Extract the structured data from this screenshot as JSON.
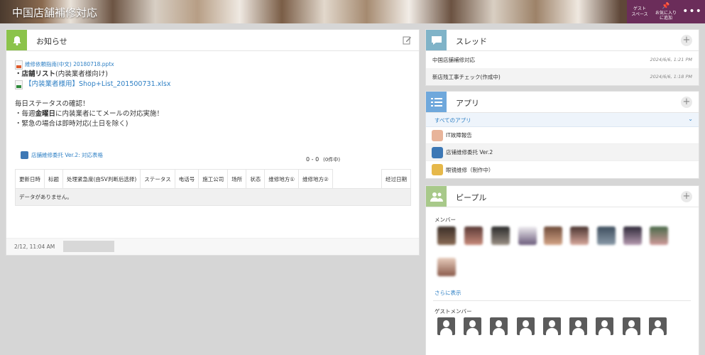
{
  "header": {
    "title": "中国店舗補修対応",
    "guest_space": [
      "ゲスト",
      "スペース"
    ],
    "favorite": [
      "お気に入り",
      "に追加"
    ],
    "more": "•••"
  },
  "notice": {
    "title": "お知らせ",
    "file1": "維修依頼指南(中文) 20180718.pptx",
    "line_store_list_bold": "・店舗リスト",
    "line_store_list_rest": "(内装業者様向け)",
    "file2": "【内装業者様用】Shop+List_201500731.xlsx",
    "status_heading": "毎日ステータスの確認！",
    "weekly_prefix": "・毎週",
    "weekly_bold": "金曜日",
    "weekly_rest": "に内装業者にてメールの対応実施！",
    "emergency": "・緊急の場合は即時対応(土日を除く)",
    "app_link": "店舗維修委托 Ver.2: 対応表格",
    "count": "0 - 0",
    "count_sub": "(0件中)",
    "columns": [
      "更新日時",
      "标题",
      "处理紧急度(由SV判断后选择)",
      "ステータス",
      "电话号",
      "施工公司",
      "场所",
      "状态",
      "维修地方①",
      "维修地方②",
      "",
      "经过日期"
    ],
    "empty": "データがありません。",
    "footer_time": "2/12, 11:04 AM"
  },
  "thread": {
    "title": "スレッド",
    "items": [
      {
        "name": "中国店舗補修対応",
        "date": "2024/6/6, 1:21 PM"
      },
      {
        "name": "新店残工事チェック(作成中)",
        "date": "2024/6/6, 1:18 PM"
      }
    ]
  },
  "apps": {
    "title": "アプリ",
    "all": "すべてのアプリ",
    "items": [
      {
        "name": "IT故障報告",
        "color": "#e8b49a"
      },
      {
        "name": "店铺维修委托 Ver.2",
        "color": "#3d78b5"
      },
      {
        "name": "眼镜维修（制作中）",
        "color": "#e6b84a"
      }
    ]
  },
  "people": {
    "title": "ピープル",
    "members_label": "メンバー",
    "more": "さらに表示",
    "guests_label": "ゲストメンバー"
  },
  "colors": {
    "header_buttons": "#6b2d5a",
    "link": "#2d7fc4",
    "notice_icon": "#8bc34a",
    "thread_icon": "#7fb3c8",
    "apps_icon": "#6fa8dc",
    "people_icon": "#a8c98a"
  }
}
